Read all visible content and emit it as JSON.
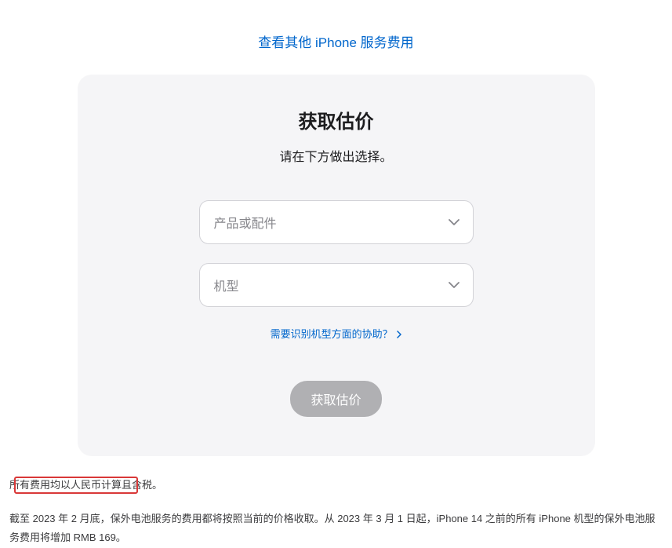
{
  "topLink": "查看其他 iPhone 服务费用",
  "card": {
    "title": "获取估价",
    "subtitle": "请在下方做出选择。",
    "select1Placeholder": "产品或配件",
    "select2Placeholder": "机型",
    "helpLink": "需要识别机型方面的协助？",
    "submitLabel": "获取估价"
  },
  "footer": {
    "line1": "所有费用均以人民币计算且含税。",
    "line2": "截至 2023 年 2 月底，保外电池服务的费用都将按照当前的价格收取。从 2023 年 3 月 1 日起，iPhone 14 之前的所有 iPhone 机型的保外电池服务费用将增加 RMB 169。"
  }
}
